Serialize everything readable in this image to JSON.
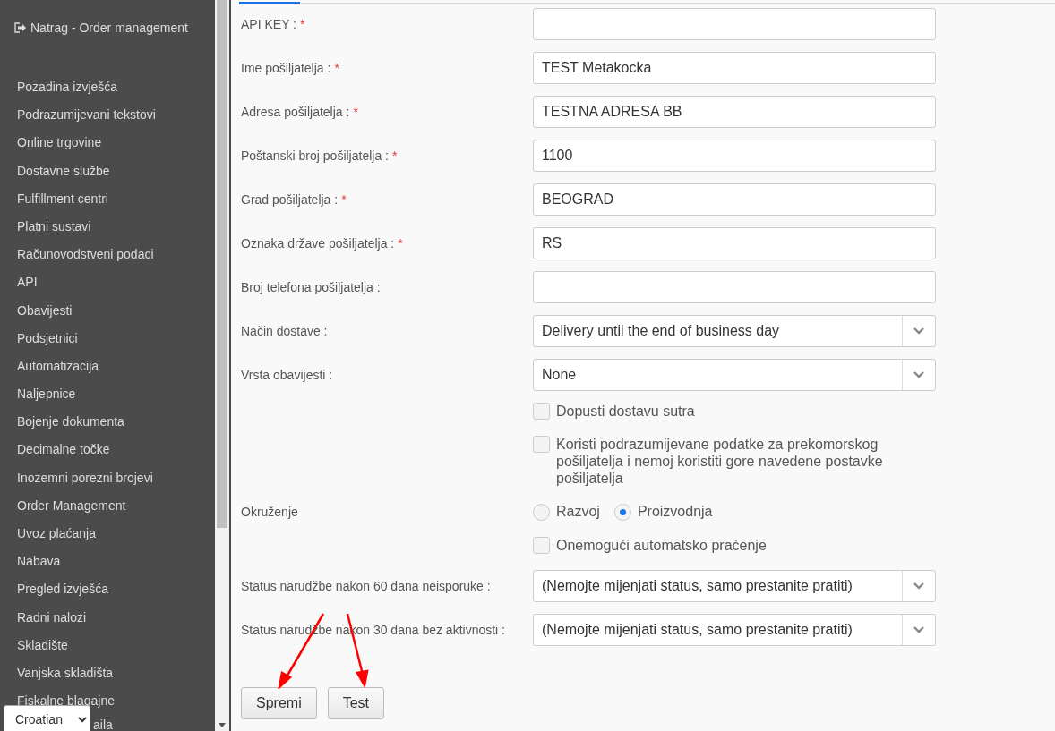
{
  "back_link": {
    "label": "Natrag - Order management"
  },
  "sidebar": {
    "items": [
      {
        "label": "Pozadina izvješća"
      },
      {
        "label": "Podrazumijevani tekstovi"
      },
      {
        "label": "Online trgovine"
      },
      {
        "label": "Dostavne službe"
      },
      {
        "label": "Fulfillment centri"
      },
      {
        "label": "Platni sustavi"
      },
      {
        "label": "Računovodstveni podaci"
      },
      {
        "label": "API"
      },
      {
        "label": "Obavijesti"
      },
      {
        "label": "Podsjetnici"
      },
      {
        "label": "Automatizacija"
      },
      {
        "label": "Naljepnice"
      },
      {
        "label": "Bojenje dokumenta"
      },
      {
        "label": "Decimalne točke"
      },
      {
        "label": "Inozemni porezni brojevi"
      },
      {
        "label": "Order Management"
      },
      {
        "label": "Uvoz plaćanja"
      },
      {
        "label": "Nabava"
      },
      {
        "label": "Pregled izvješća"
      },
      {
        "label": "Radni nalozi"
      },
      {
        "label": "Skladište"
      },
      {
        "label": "Vanjska skladišta"
      },
      {
        "label": "Fiskalne blagajne"
      }
    ],
    "cut_item": "aila"
  },
  "language_select": {
    "value": "Croatian"
  },
  "form": {
    "rows": [
      {
        "kind": "text",
        "label": "API KEY :",
        "required_mark": "*"
      },
      {
        "kind": "text",
        "label": "Ime pošiljatelja :",
        "required_mark": "*",
        "value": "TEST Metakocka"
      },
      {
        "kind": "text",
        "label": "Adresa pošiljatelja :",
        "required_mark": "*",
        "value": "TESTNA ADRESA BB"
      },
      {
        "kind": "text",
        "label": "Poštanski broj pošiljatelja :",
        "required_mark": "*",
        "value": "1100"
      },
      {
        "kind": "text",
        "label": "Grad pošiljatelja :",
        "required_mark": "*",
        "value": "BEOGRAD"
      },
      {
        "kind": "text",
        "label": "Oznaka države pošiljatelja :",
        "required_mark": "*",
        "value": "RS"
      },
      {
        "kind": "text",
        "label": "Broj telefona pošiljatelja :"
      },
      {
        "kind": "select",
        "label": "Način dostave :",
        "value": "Delivery until the end of business day"
      },
      {
        "kind": "select",
        "label": "Vrsta obavijesti :",
        "value": "None"
      },
      {
        "kind": "checkbox",
        "text": "Dopusti dostavu sutra",
        "checked": false
      },
      {
        "kind": "checkbox",
        "text": "Koristi podrazumijevane podatke za prekomorskog pošiljatelja i nemoj koristiti gore navedene postavke pošiljatelja",
        "checked": false
      },
      {
        "kind": "radio",
        "label": "Okruženje",
        "options": [
          {
            "label": "Razvoj",
            "selected": false
          },
          {
            "label": "Proizvodnja",
            "selected": true
          }
        ]
      },
      {
        "kind": "checkbox",
        "text": "Onemogući automatsko praćenje",
        "checked": false
      },
      {
        "kind": "select",
        "label": "Status narudžbe nakon 60 dana neisporuke :",
        "value": "(Nemojte mijenjati status, samo prestanite pratiti)"
      },
      {
        "kind": "select",
        "label": "Status narudžbe nakon 30 dana bez aktivnosti :",
        "value": "(Nemojte mijenjati status, samo prestanite pratiti)"
      }
    ]
  },
  "buttons": [
    {
      "label": "Spremi"
    },
    {
      "label": "Test"
    }
  ]
}
